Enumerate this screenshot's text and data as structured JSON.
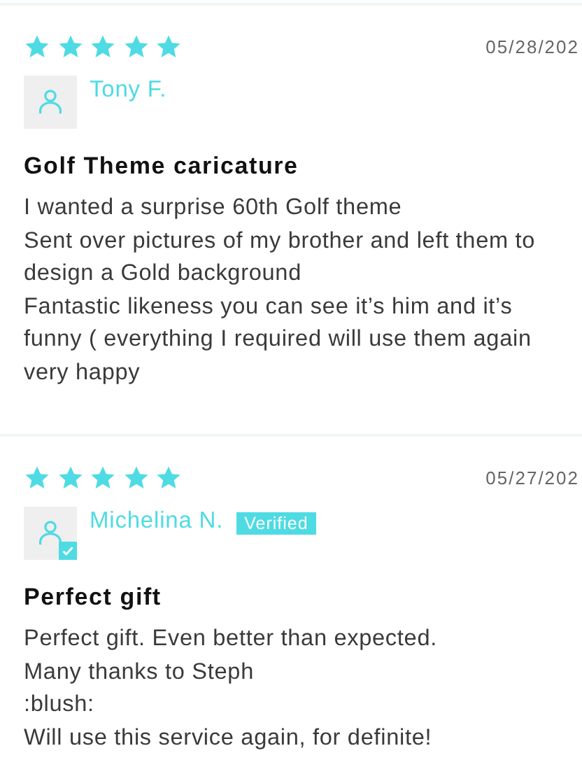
{
  "reviews": [
    {
      "stars": 5,
      "date": "05/28/202",
      "author": "Tony F.",
      "verified": false,
      "title": "Golf Theme caricature",
      "body": [
        "I wanted a surprise 60th Golf theme",
        "Sent over pictures of my brother and left them to design a Gold background",
        "Fantastic likeness you can see it’s him and it’s funny ( everything I required will use them again very happy"
      ]
    },
    {
      "stars": 5,
      "date": "05/27/202",
      "author": "Michelina N.",
      "verified": true,
      "badge": "Verified",
      "title": "Perfect gift",
      "body": [
        "Perfect gift. Even better than expected.",
        "Many thanks to Steph",
        ":blush:",
        "Will use this service again, for definite!"
      ]
    }
  ]
}
